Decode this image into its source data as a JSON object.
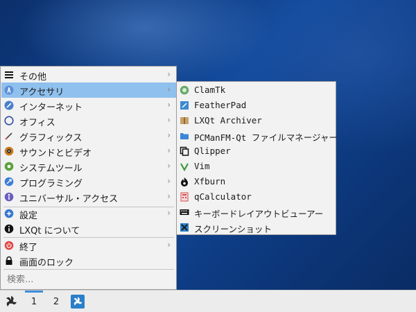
{
  "menu": {
    "items": [
      {
        "label": "その他",
        "icon": "list-icon",
        "has_submenu": true
      },
      {
        "label": "アクセサリ",
        "icon": "accessories-icon",
        "has_submenu": true,
        "active": true
      },
      {
        "label": "インターネット",
        "icon": "internet-icon",
        "has_submenu": true
      },
      {
        "label": "オフィス",
        "icon": "office-icon",
        "has_submenu": true
      },
      {
        "label": "グラフィックス",
        "icon": "graphics-icon",
        "has_submenu": true
      },
      {
        "label": "サウンドとビデオ",
        "icon": "multimedia-icon",
        "has_submenu": true
      },
      {
        "label": "システムツール",
        "icon": "system-tools-icon",
        "has_submenu": true
      },
      {
        "label": "プログラミング",
        "icon": "programming-icon",
        "has_submenu": true
      },
      {
        "label": "ユニバーサル・アクセス",
        "icon": "accessibility-icon",
        "has_submenu": true
      }
    ],
    "settings_label": "設定",
    "about_label": "LXQt について",
    "leave_label": "終了",
    "lock_label": "画面のロック",
    "search_placeholder": "検索..."
  },
  "chevron": "›",
  "submenu": {
    "items": [
      {
        "label": "ClamTk",
        "icon": "clamtk-icon"
      },
      {
        "label": "FeatherPad",
        "icon": "featherpad-icon"
      },
      {
        "label": "LXQt Archiver",
        "icon": "archiver-icon"
      },
      {
        "label": "PCManFM-Qt ファイルマネージャー",
        "icon": "file-manager-icon"
      },
      {
        "label": "Qlipper",
        "icon": "qlipper-icon"
      },
      {
        "label": "Vim",
        "icon": "vim-icon"
      },
      {
        "label": "Xfburn",
        "icon": "xfburn-icon"
      },
      {
        "label": "qCalculator",
        "icon": "calculator-icon"
      },
      {
        "label": "キーボードレイアウトビューアー",
        "icon": "keyboard-icon"
      },
      {
        "label": "スクリーンショット",
        "icon": "screenshot-icon"
      }
    ]
  },
  "taskbar": {
    "workspace_1": "1",
    "workspace_2": "2",
    "active_workspace": "1"
  },
  "colors": {
    "highlight": "#8fc0ee",
    "menu_bg": "#f2f2f2",
    "taskbar_accent": "#3c8fdb",
    "desktop": "#124a9c"
  }
}
